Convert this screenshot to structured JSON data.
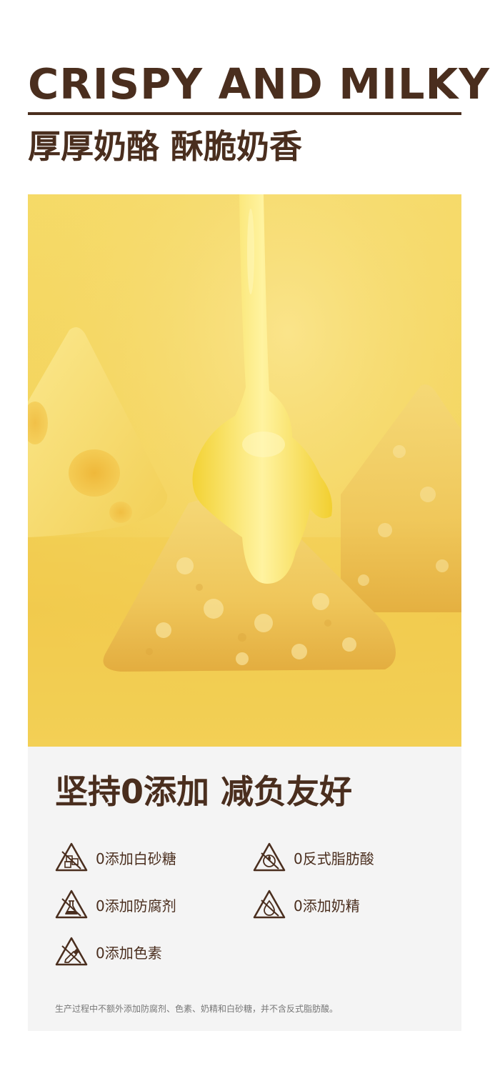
{
  "header": {
    "title_en": "CRISPY AND MILKY",
    "title_cn": "厚厚奶酪 酥脆奶香"
  },
  "photo": {
    "subject": "cheese-crackers-photo"
  },
  "panel": {
    "title": "坚持0添加  减负友好",
    "features": [
      {
        "icon": "sugar-cubes-icon",
        "label": "0添加白砂糖"
      },
      {
        "icon": "no-trans-fat-icon",
        "label": "0反式脂肪酸"
      },
      {
        "icon": "preservative-flask-icon",
        "label": "0添加防腐剂"
      },
      {
        "icon": "no-milk-essence-icon",
        "label": "0添加奶精"
      },
      {
        "icon": "no-color-icon",
        "label": "0添加色素"
      }
    ],
    "footnote": "生产过程中不额外添加防腐剂、色素、奶精和白砂糖，并不含反式脂肪酸。"
  },
  "colors": {
    "text_brown": "#4a2e1e",
    "panel_bg": "#f4f4f4",
    "photo_yellow": "#f4d35a"
  }
}
